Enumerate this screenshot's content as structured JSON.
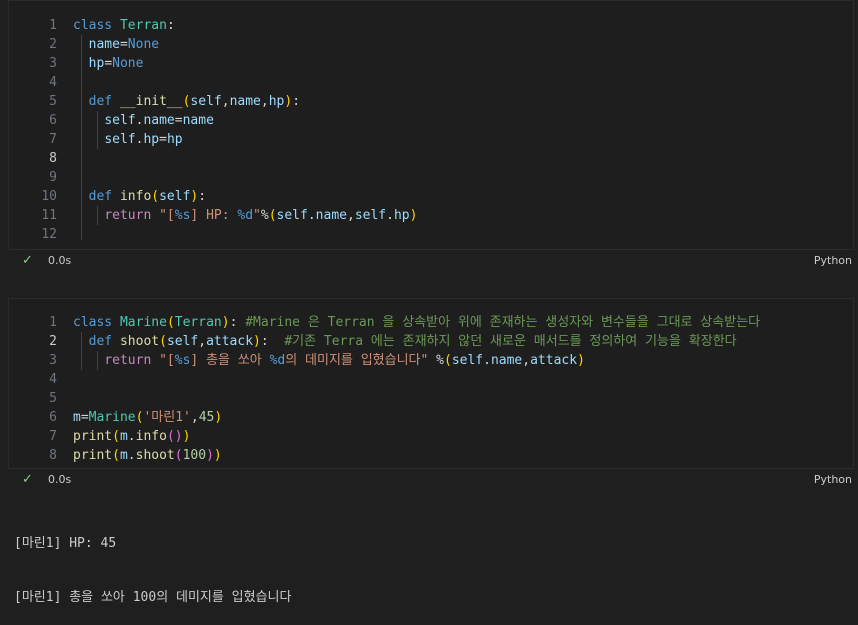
{
  "cell1": {
    "lines": [
      {
        "n": "1",
        "tokens": [
          [
            "kw",
            "class "
          ],
          [
            "cls",
            "Terran"
          ],
          [
            "pun",
            ":"
          ]
        ]
      },
      {
        "n": "2",
        "tokens": [
          [
            "pun",
            "  "
          ],
          [
            "var",
            "name"
          ],
          [
            "pun",
            "="
          ],
          [
            "kw",
            "None"
          ]
        ]
      },
      {
        "n": "3",
        "tokens": [
          [
            "pun",
            "  "
          ],
          [
            "var",
            "hp"
          ],
          [
            "pun",
            "="
          ],
          [
            "kw",
            "None"
          ]
        ]
      },
      {
        "n": "4",
        "tokens": []
      },
      {
        "n": "5",
        "tokens": [
          [
            "pun",
            "  "
          ],
          [
            "kw",
            "def "
          ],
          [
            "fn",
            "__init__"
          ],
          [
            "br1",
            "("
          ],
          [
            "var",
            "self"
          ],
          [
            "pun",
            ","
          ],
          [
            "var",
            "name"
          ],
          [
            "pun",
            ","
          ],
          [
            "var",
            "hp"
          ],
          [
            "br1",
            ")"
          ],
          [
            "pun",
            ":"
          ]
        ]
      },
      {
        "n": "6",
        "tokens": [
          [
            "pun",
            "    "
          ],
          [
            "var",
            "self"
          ],
          [
            "pun",
            "."
          ],
          [
            "var",
            "name"
          ],
          [
            "pun",
            "="
          ],
          [
            "var",
            "name"
          ]
        ]
      },
      {
        "n": "7",
        "tokens": [
          [
            "pun",
            "    "
          ],
          [
            "var",
            "self"
          ],
          [
            "pun",
            "."
          ],
          [
            "var",
            "hp"
          ],
          [
            "pun",
            "="
          ],
          [
            "var",
            "hp"
          ]
        ]
      },
      {
        "n": "8",
        "tokens": [],
        "current": true
      },
      {
        "n": "9",
        "tokens": []
      },
      {
        "n": "10",
        "tokens": [
          [
            "pun",
            "  "
          ],
          [
            "kw",
            "def "
          ],
          [
            "fn",
            "info"
          ],
          [
            "br1",
            "("
          ],
          [
            "var",
            "self"
          ],
          [
            "br1",
            ")"
          ],
          [
            "pun",
            ":"
          ]
        ]
      },
      {
        "n": "11",
        "tokens": [
          [
            "pun",
            "    "
          ],
          [
            "ret",
            "return "
          ],
          [
            "str",
            "\"["
          ],
          [
            "fmt",
            "%s"
          ],
          [
            "str",
            "] HP: "
          ],
          [
            "fmt",
            "%d"
          ],
          [
            "str",
            "\""
          ],
          [
            "pun",
            "%"
          ],
          [
            "br1",
            "("
          ],
          [
            "var",
            "self"
          ],
          [
            "pun",
            "."
          ],
          [
            "var",
            "name"
          ],
          [
            "pun",
            ","
          ],
          [
            "var",
            "self"
          ],
          [
            "pun",
            "."
          ],
          [
            "var",
            "hp"
          ],
          [
            "br1",
            ")"
          ]
        ]
      },
      {
        "n": "12",
        "tokens": []
      }
    ],
    "status_time": "0.0s",
    "status_lang": "Python",
    "check_icon": "✓"
  },
  "cell2": {
    "lines": [
      {
        "n": "1",
        "tokens": [
          [
            "kw",
            "class "
          ],
          [
            "cls",
            "Marine"
          ],
          [
            "br1",
            "("
          ],
          [
            "cls",
            "Terran"
          ],
          [
            "br1",
            ")"
          ],
          [
            "pun",
            ": "
          ],
          [
            "cmt",
            "#Marine 은 Terran 을 상속받아 위에 존재하는 생성자와 변수들을 그대로 상속받는다"
          ]
        ]
      },
      {
        "n": "2",
        "tokens": [
          [
            "pun",
            "  "
          ],
          [
            "kw",
            "def "
          ],
          [
            "fn",
            "shoot"
          ],
          [
            "br1",
            "("
          ],
          [
            "var",
            "self"
          ],
          [
            "pun",
            ","
          ],
          [
            "var",
            "attack"
          ],
          [
            "br1",
            ")"
          ],
          [
            "pun",
            ":  "
          ],
          [
            "cmt",
            "#기존 Terra 에는 존재하지 않던 새로운 매서드를 정의하여 기능을 확장한다"
          ]
        ],
        "current": true
      },
      {
        "n": "3",
        "tokens": [
          [
            "pun",
            "    "
          ],
          [
            "ret",
            "return "
          ],
          [
            "str",
            "\"["
          ],
          [
            "fmt",
            "%s"
          ],
          [
            "str",
            "] 총을 쏘아 "
          ],
          [
            "fmt",
            "%d"
          ],
          [
            "str",
            "의 데미지를 입혔습니다\""
          ],
          [
            "pun",
            " %"
          ],
          [
            "br1",
            "("
          ],
          [
            "var",
            "self"
          ],
          [
            "pun",
            "."
          ],
          [
            "var",
            "name"
          ],
          [
            "pun",
            ","
          ],
          [
            "var",
            "attack"
          ],
          [
            "br1",
            ")"
          ]
        ]
      },
      {
        "n": "4",
        "tokens": []
      },
      {
        "n": "5",
        "tokens": []
      },
      {
        "n": "6",
        "tokens": [
          [
            "var",
            "m"
          ],
          [
            "pun",
            "="
          ],
          [
            "cls",
            "Marine"
          ],
          [
            "br1",
            "("
          ],
          [
            "str",
            "'마린1'"
          ],
          [
            "pun",
            ","
          ],
          [
            "num",
            "45"
          ],
          [
            "br1",
            ")"
          ]
        ]
      },
      {
        "n": "7",
        "tokens": [
          [
            "fn",
            "print"
          ],
          [
            "br1",
            "("
          ],
          [
            "var",
            "m"
          ],
          [
            "pun",
            "."
          ],
          [
            "fn",
            "info"
          ],
          [
            "br2",
            "()"
          ],
          [
            "br1",
            ")"
          ]
        ]
      },
      {
        "n": "8",
        "tokens": [
          [
            "fn",
            "print"
          ],
          [
            "br1",
            "("
          ],
          [
            "var",
            "m"
          ],
          [
            "pun",
            "."
          ],
          [
            "fn",
            "shoot"
          ],
          [
            "br2",
            "("
          ],
          [
            "num",
            "100"
          ],
          [
            "br2",
            ")"
          ],
          [
            "br1",
            ")"
          ]
        ]
      }
    ],
    "status_time": "0.0s",
    "status_lang": "Python",
    "check_icon": "✓"
  },
  "output": {
    "line1": "[마린1] HP: 45",
    "line2": "[마린1] 총을 쏘아 100의 데미지를 입혔습니다"
  }
}
